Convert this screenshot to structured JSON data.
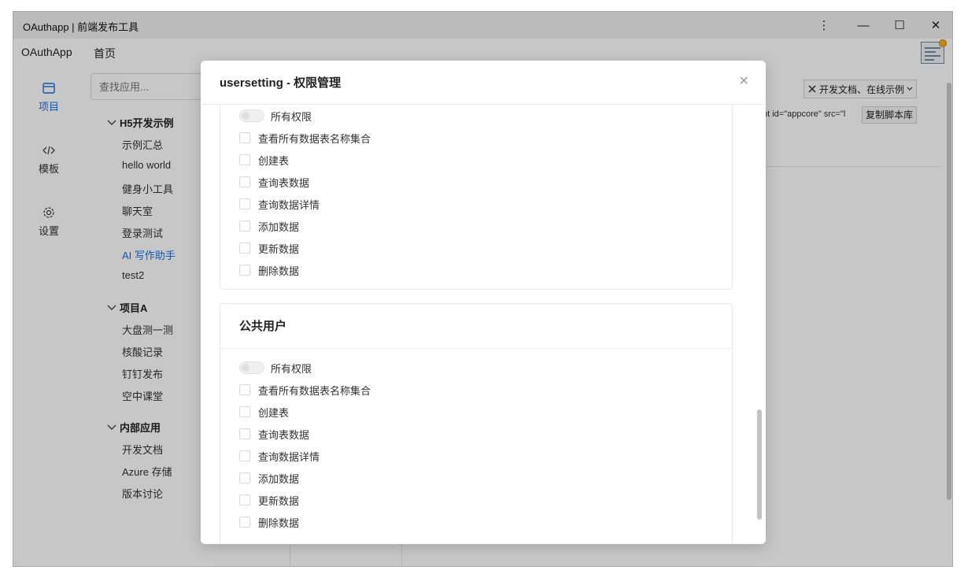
{
  "window": {
    "title": "OAuthapp | 前端发布工具",
    "more": "⋮",
    "minimize": "—",
    "maximize": "☐",
    "close": "✕"
  },
  "menubar": {
    "app_name": "OAuthApp",
    "home": "首页"
  },
  "leftnav": {
    "items": [
      {
        "label": "项目",
        "icon": "window-icon",
        "active": true
      },
      {
        "label": "模板",
        "icon": "code-icon",
        "active": false
      },
      {
        "label": "设置",
        "icon": "gear-icon",
        "active": false
      }
    ]
  },
  "tree": {
    "search_placeholder": "查找应用...",
    "groups": [
      {
        "title": "H5开发示例",
        "items": [
          "示例汇总",
          "hello world",
          "健身小工具",
          "聊天室",
          "登录测试",
          "AI 写作助手",
          "test2"
        ]
      },
      {
        "title": "项目A",
        "items": [
          "大盘测一测",
          "核酸记录",
          "钉钉发布",
          "空中课堂"
        ]
      },
      {
        "title": "内部应用",
        "items": [
          "开发文档",
          "Azure 存储",
          "版本讨论"
        ]
      }
    ],
    "active_item": "AI 写作助手"
  },
  "main": {
    "doc_select": "开发文档、在线示例",
    "code_snippet": "pt id=\"appcore\" src=\"l",
    "copy_button": "复制脚本库"
  },
  "modal": {
    "title": "usersetting - 权限管理",
    "close": "×",
    "cards": [
      {
        "title": "",
        "toggle_label": "所有权限",
        "permissions": [
          "查看所有数据表名称集合",
          "创建表",
          "查询表数据",
          "查询数据详情",
          "添加数据",
          "更新数据",
          "删除数据"
        ]
      },
      {
        "title": "公共用户",
        "toggle_label": "所有权限",
        "permissions": [
          "查看所有数据表名称集合",
          "创建表",
          "查询表数据",
          "查询数据详情",
          "添加数据",
          "更新数据",
          "删除数据"
        ]
      }
    ]
  },
  "colors": {
    "accent": "#1e6fd9",
    "overlay": "rgba(0,0,0,0.22)"
  }
}
